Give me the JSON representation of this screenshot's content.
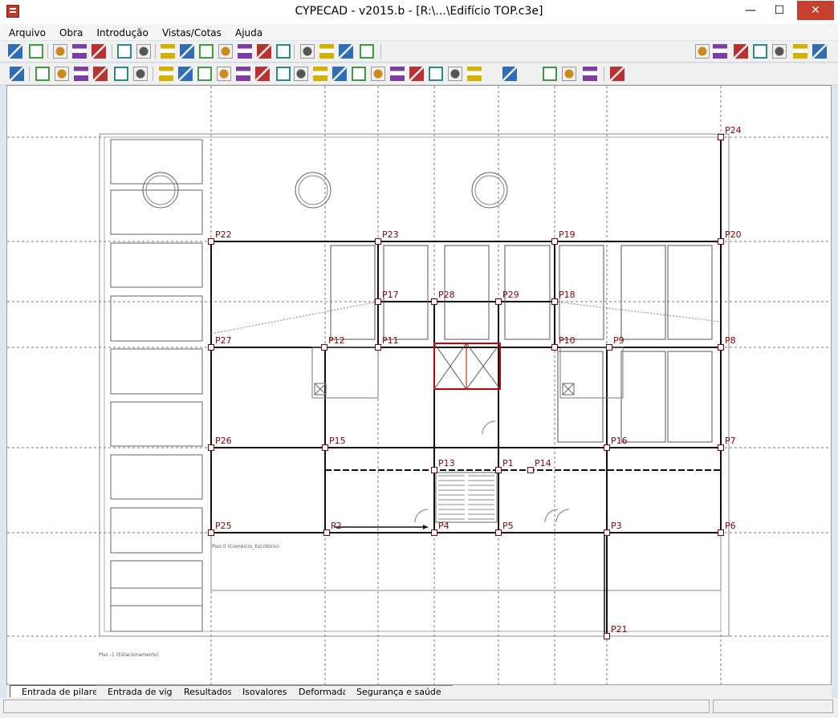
{
  "window": {
    "title": "CYPECAD - v2015.b - [R:\\...\\Edifício TOP.c3e]",
    "minimize": "—",
    "maximize": "☐",
    "close": "✕"
  },
  "menu": [
    "Arquivo",
    "Obra",
    "Introdução",
    "Vistas/Cotas",
    "Ajuda"
  ],
  "toolbar1_icons": [
    "open-folder-icon",
    "save-icon",
    "report-icon",
    "table-icon",
    "magnet-icon",
    "undo-icon",
    "redo-icon",
    "select-icon",
    "zoom-window-icon",
    "zoom-extents-icon",
    "redraw-icon",
    "zoom-dynamic-icon",
    "pan-icon",
    "view-3d-icon",
    "binoculars-icon",
    "axis-icon",
    "level-icon",
    "measure-icon",
    "help-icon",
    "globe-icon",
    "print-icon",
    "export-icon",
    "import-icon",
    "settings-icon",
    "exit-icon"
  ],
  "toolbar2_icons": [
    "columns-list-icon",
    "add-column-icon",
    "edit-column-icon",
    "column-data-icon",
    "column-start-icon",
    "column-end-icon",
    "move-column-icon",
    "raise-column-icon",
    "add-wall-icon",
    "add-beam-icon",
    "edit-beam-icon",
    "delete-column-icon",
    "adjust-icon",
    "copy-icon",
    "rotate-icon",
    "angle-icon",
    "search-icon",
    "reference-icon",
    "support-icon",
    "foundation-icon",
    "split-icon",
    "joint-icon",
    "load-icon",
    "formula-icon",
    "grey-icon",
    "report-columns-icon",
    "floor-icon",
    "sections-icon"
  ],
  "drawing": {
    "columns": [
      "P1",
      "P2",
      "P3",
      "P4",
      "P5",
      "P6",
      "P7",
      "P8",
      "P9",
      "P10",
      "P11",
      "P12",
      "P13",
      "P14",
      "P15",
      "P16",
      "P17",
      "P18",
      "P19",
      "P20",
      "P21",
      "P22",
      "P23",
      "P24",
      "P25",
      "P26",
      "P27",
      "P28",
      "P29"
    ],
    "floor_label_0": "Piso 0 (Comércio_Escritório)",
    "floor_label_minus1": "Piso -1 (Estacionamento)"
  },
  "tabs": [
    "Entrada de pilares",
    "Entrada de vigas",
    "Resultados",
    "Isovalores",
    "Deformada",
    "Segurança e saúde"
  ],
  "active_tab": "Entrada de pilares",
  "colors": {
    "column_label": "#8b0000",
    "stair_core": "#cc0000"
  }
}
